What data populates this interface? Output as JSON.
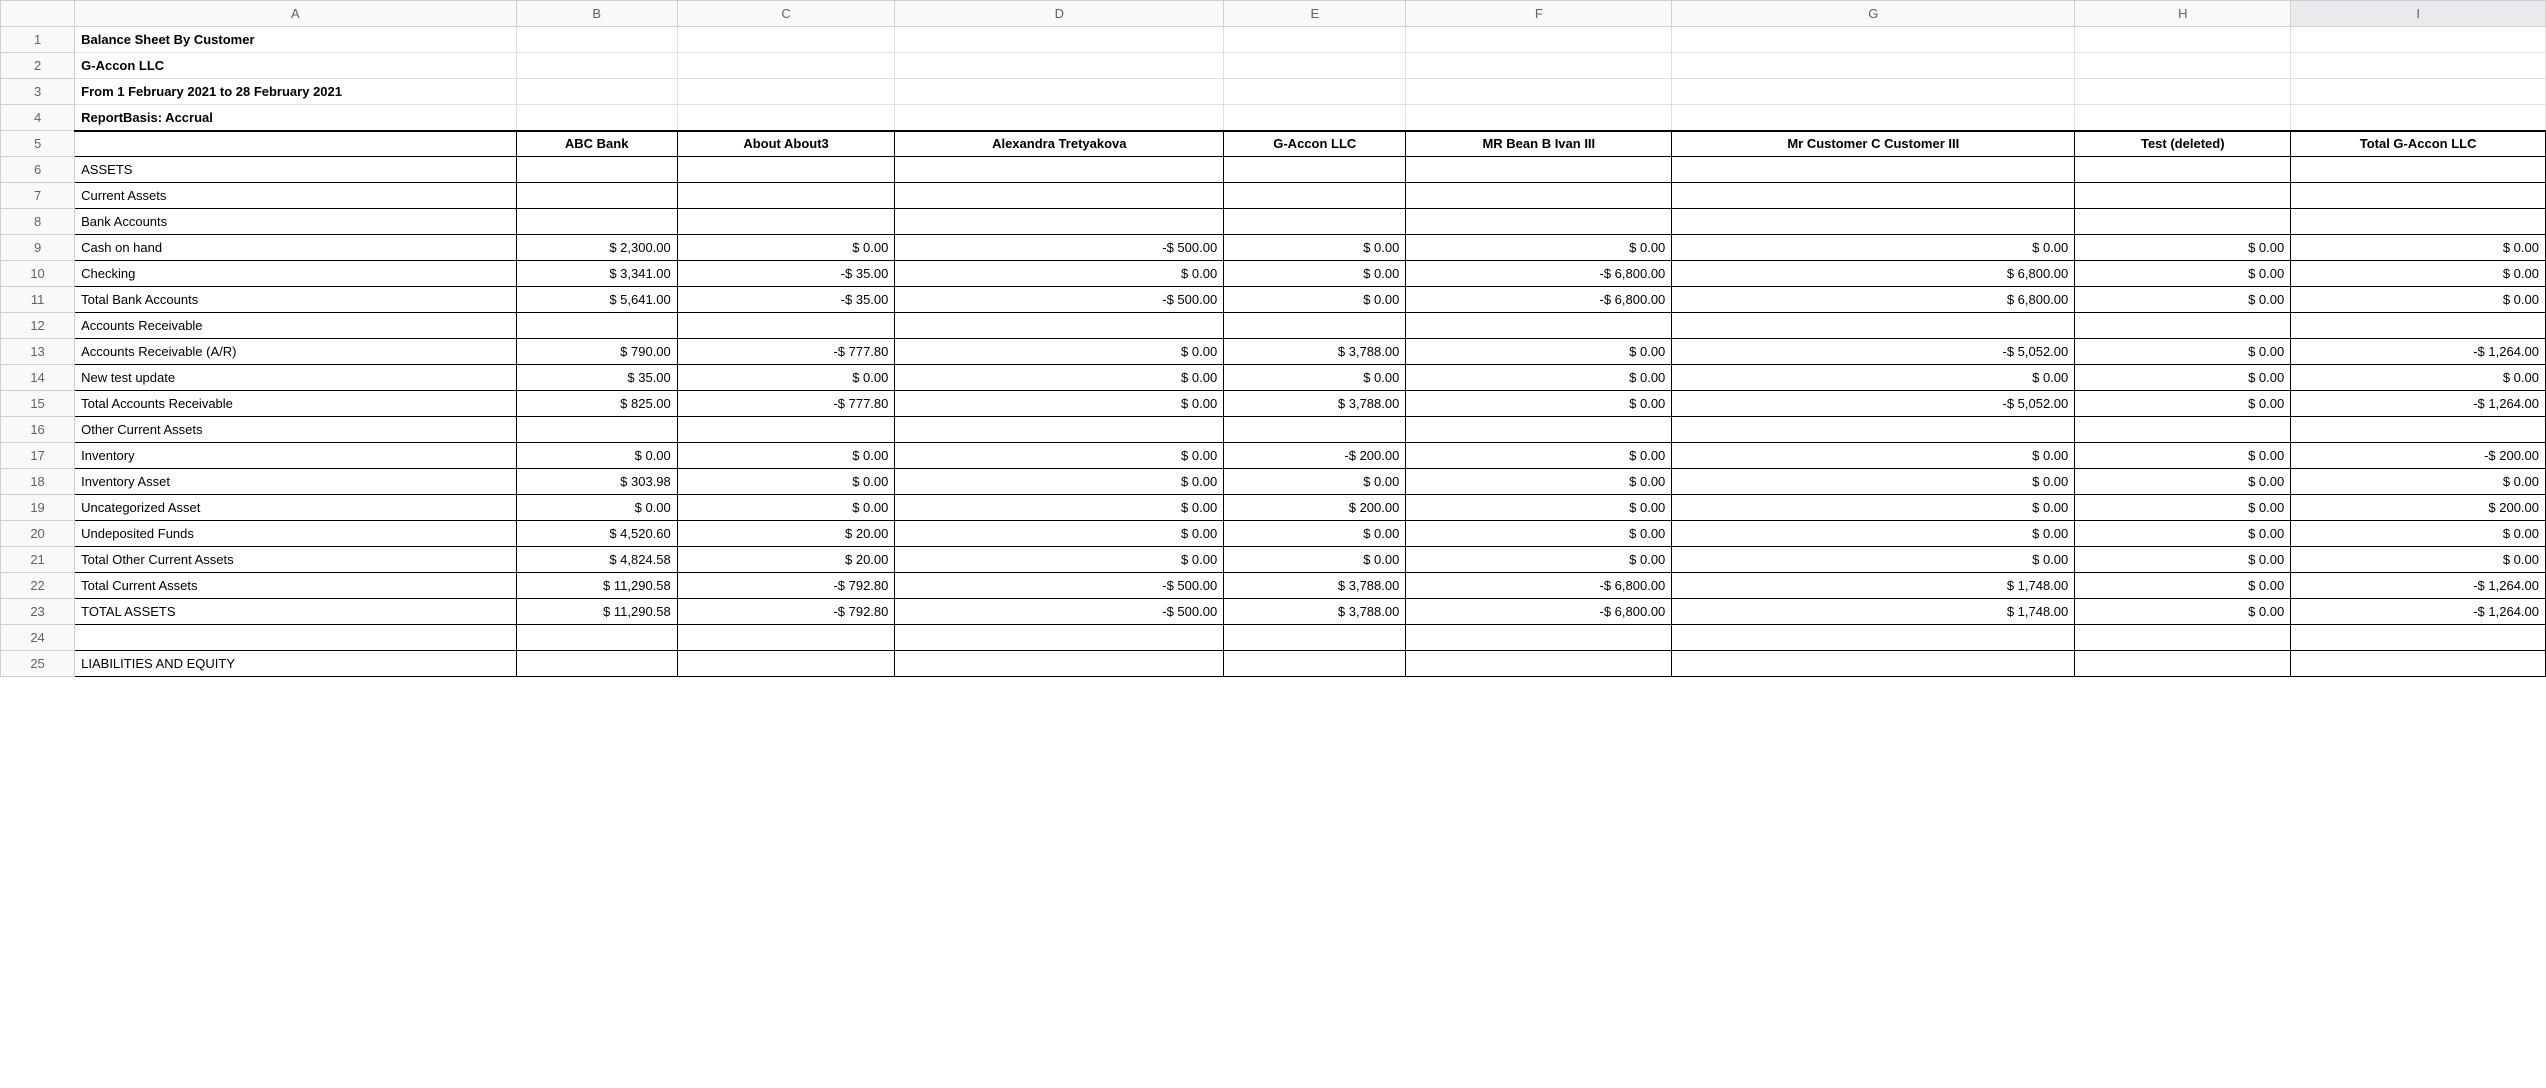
{
  "columns": [
    "A",
    "B",
    "C",
    "D",
    "E",
    "F",
    "G",
    "H",
    "I"
  ],
  "rownums": [
    "1",
    "2",
    "3",
    "4",
    "5",
    "6",
    "7",
    "8",
    "9",
    "10",
    "11",
    "12",
    "13",
    "14",
    "15",
    "16",
    "17",
    "18",
    "19",
    "20",
    "21",
    "22",
    "23",
    "24",
    "25"
  ],
  "title": "Balance Sheet By Customer",
  "company": "G-Accon LLC",
  "period": "From 1 February 2021 to 28 February 2021",
  "basis": "ReportBasis: Accrual",
  "headers": {
    "B": "ABC Bank",
    "C": "About About3",
    "D": "Alexandra Tretyakova",
    "E": "G-Accon LLC",
    "F": "MR Bean B Ivan III",
    "G": "Mr Customer C Customer III",
    "H": "Test (deleted)",
    "I": "Total G-Accon LLC"
  },
  "rows": [
    {
      "label": "ASSETS",
      "vals": [
        "",
        "",
        "",
        "",
        "",
        "",
        "",
        ""
      ]
    },
    {
      "label": "Current Assets",
      "vals": [
        "",
        "",
        "",
        "",
        "",
        "",
        "",
        ""
      ]
    },
    {
      "label": "Bank Accounts",
      "vals": [
        "",
        "",
        "",
        "",
        "",
        "",
        "",
        ""
      ]
    },
    {
      "label": "Cash on hand",
      "vals": [
        "$ 2,300.00",
        "$ 0.00",
        "-$ 500.00",
        "$ 0.00",
        "$ 0.00",
        "$ 0.00",
        "$ 0.00",
        "$ 0.00"
      ]
    },
    {
      "label": "Checking",
      "vals": [
        "$ 3,341.00",
        "-$ 35.00",
        "$ 0.00",
        "$ 0.00",
        "-$ 6,800.00",
        "$ 6,800.00",
        "$ 0.00",
        "$ 0.00"
      ]
    },
    {
      "label": "Total Bank Accounts",
      "vals": [
        "$ 5,641.00",
        "-$ 35.00",
        "-$ 500.00",
        "$ 0.00",
        "-$ 6,800.00",
        "$ 6,800.00",
        "$ 0.00",
        "$ 0.00"
      ]
    },
    {
      "label": "Accounts Receivable",
      "vals": [
        "",
        "",
        "",
        "",
        "",
        "",
        "",
        ""
      ]
    },
    {
      "label": "Accounts Receivable (A/R)",
      "vals": [
        "$ 790.00",
        "-$ 777.80",
        "$ 0.00",
        "$ 3,788.00",
        "$ 0.00",
        "-$ 5,052.00",
        "$ 0.00",
        "-$ 1,264.00"
      ]
    },
    {
      "label": "New test update",
      "vals": [
        "$ 35.00",
        "$ 0.00",
        "$ 0.00",
        "$ 0.00",
        "$ 0.00",
        "$ 0.00",
        "$ 0.00",
        "$ 0.00"
      ]
    },
    {
      "label": "Total Accounts Receivable",
      "vals": [
        "$ 825.00",
        "-$ 777.80",
        "$ 0.00",
        "$ 3,788.00",
        "$ 0.00",
        "-$ 5,052.00",
        "$ 0.00",
        "-$ 1,264.00"
      ]
    },
    {
      "label": "Other Current Assets",
      "vals": [
        "",
        "",
        "",
        "",
        "",
        "",
        "",
        ""
      ]
    },
    {
      "label": "Inventory",
      "vals": [
        "$ 0.00",
        "$ 0.00",
        "$ 0.00",
        "-$ 200.00",
        "$ 0.00",
        "$ 0.00",
        "$ 0.00",
        "-$ 200.00"
      ]
    },
    {
      "label": "Inventory Asset",
      "vals": [
        "$ 303.98",
        "$ 0.00",
        "$ 0.00",
        "$ 0.00",
        "$ 0.00",
        "$ 0.00",
        "$ 0.00",
        "$ 0.00"
      ]
    },
    {
      "label": "Uncategorized Asset",
      "vals": [
        "$ 0.00",
        "$ 0.00",
        "$ 0.00",
        "$ 200.00",
        "$ 0.00",
        "$ 0.00",
        "$ 0.00",
        "$ 200.00"
      ]
    },
    {
      "label": "Undeposited Funds",
      "vals": [
        "$ 4,520.60",
        "$ 20.00",
        "$ 0.00",
        "$ 0.00",
        "$ 0.00",
        "$ 0.00",
        "$ 0.00",
        "$ 0.00"
      ]
    },
    {
      "label": "Total Other Current Assets",
      "vals": [
        "$ 4,824.58",
        "$ 20.00",
        "$ 0.00",
        "$ 0.00",
        "$ 0.00",
        "$ 0.00",
        "$ 0.00",
        "$ 0.00"
      ]
    },
    {
      "label": "Total Current Assets",
      "vals": [
        "$ 11,290.58",
        "-$ 792.80",
        "-$ 500.00",
        "$ 3,788.00",
        "-$ 6,800.00",
        "$ 1,748.00",
        "$ 0.00",
        "-$ 1,264.00"
      ]
    },
    {
      "label": "TOTAL ASSETS",
      "vals": [
        "$ 11,290.58",
        "-$ 792.80",
        "-$ 500.00",
        "$ 3,788.00",
        "-$ 6,800.00",
        "$ 1,748.00",
        "$ 0.00",
        "-$ 1,264.00"
      ]
    },
    {
      "label": "",
      "vals": [
        "",
        "",
        "",
        "",
        "",
        "",
        "",
        ""
      ]
    },
    {
      "label": "LIABILITIES AND EQUITY",
      "vals": [
        "",
        "",
        "",
        "",
        "",
        "",
        "",
        ""
      ]
    }
  ]
}
